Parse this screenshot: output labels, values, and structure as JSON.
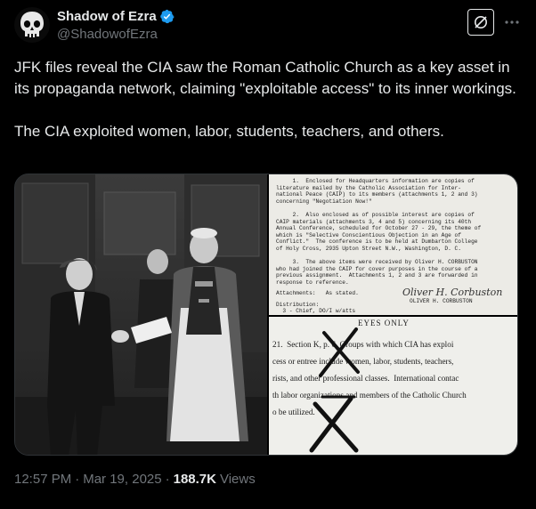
{
  "author": {
    "name": "Shadow of Ezra",
    "handle": "@ShadowofEzra",
    "verified": true
  },
  "tweet": {
    "paragraph1": "JFK files reveal the CIA saw the Roman Catholic Church as a key asset in its propaganda network, claiming \"exploitable access\" to its inner workings.",
    "paragraph2": "The CIA exploited women, labor, students, teachers, and others."
  },
  "doc_top": {
    "lines": [
      "     1.  Enclosed for Headquarters information are copies of",
      "literature mailed by the Catholic Association for Inter-",
      "national Peace (CAIP) to its members (attachments 1, 2 and 3)",
      "concerning \"Negotiation Now!\"",
      "",
      "     2.  Also enclosed as of possible interest are copies of",
      "CAIP materials (attachments 3, 4 and 5) concerning its 40th",
      "Annual Conference, scheduled for October 27 - 29, the theme of",
      "which is \"Selective Conscientious Objection in an Age of",
      "Conflict.\"  The conference is to be held at Dumbarton College",
      "of Holy Cross, 2935 Upton Street N.W., Washington, D. C.",
      "",
      "     3.  The above items were received by Oliver H. CORBUSTON",
      "who had joined the CAIP for cover purposes in the course of a",
      "previous assignment.  Attachments 1, 2 and 3 are forwarded in",
      "response to reference."
    ],
    "signature": "Oliver H. Corbuston",
    "signature_typed": "OLIVER H. CORBUSTON",
    "attachments": "Attachments:   As stated.",
    "distribution": "Distribution:",
    "distribution_line": "  3 - Chief, DO/I w/atts"
  },
  "doc_bottom": {
    "header": "EYES ONLY",
    "lines": [
      "21.  Section K, p. 6, Groups with which CIA has exploi",
      "cess or entree include women, labor, students, teachers,",
      "rists, and other professional classes.  International contac",
      "th labor organizations and members of the Catholic Church",
      "o be utilized."
    ]
  },
  "meta": {
    "time": "12:57 PM",
    "separator": "·",
    "date": "Mar 19, 2025",
    "views_count": "188.7K",
    "views_label": "Views"
  },
  "colors": {
    "background": "#000000",
    "text": "#e7e9ea",
    "secondary": "#71767b",
    "verified": "#1d9bf0",
    "border": "#2f3336"
  },
  "icons": {
    "avatar": "skull-avatar-icon",
    "verified": "verified-badge-icon",
    "grok": "grok-icon",
    "more": "more-icon"
  }
}
